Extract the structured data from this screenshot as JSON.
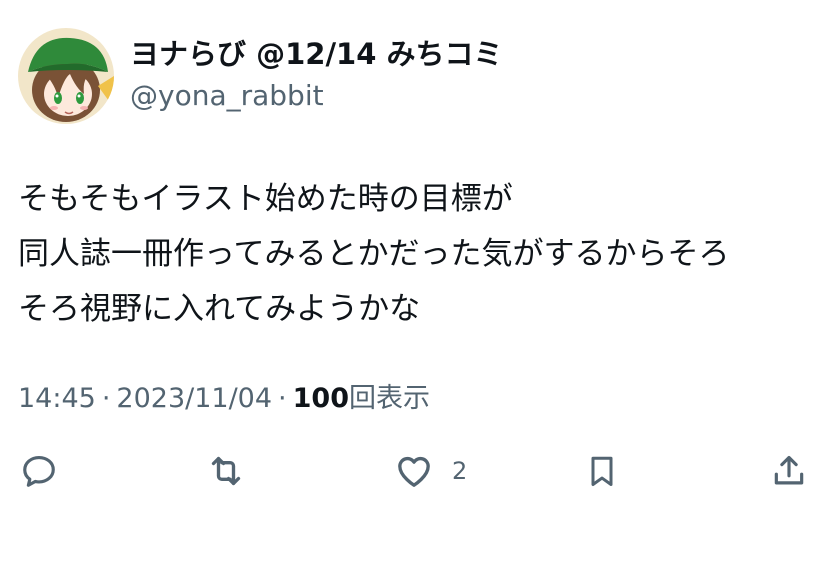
{
  "author": {
    "display_name": "ヨナらび @12/14 みちコミ",
    "handle": "@yona_rabbit"
  },
  "tweet": {
    "lines": [
      "そもそもイラスト始めた時の目標が",
      "同人誌一冊作ってみるとかだった気がするからそろ",
      "そろ視野に入れてみようかな"
    ],
    "time": "14:45",
    "date": "2023/11/04",
    "separator": "·",
    "views_count": "100",
    "views_label": "回表示"
  },
  "actions": {
    "reply": {
      "icon": "reply-icon",
      "count": ""
    },
    "retweet": {
      "icon": "retweet-icon",
      "count": ""
    },
    "like": {
      "icon": "heart-icon",
      "count": "2"
    },
    "bookmark": {
      "icon": "bookmark-icon",
      "count": ""
    },
    "share": {
      "icon": "share-icon",
      "count": ""
    }
  },
  "colors": {
    "text_primary": "#0f1419",
    "text_secondary": "#536471"
  }
}
